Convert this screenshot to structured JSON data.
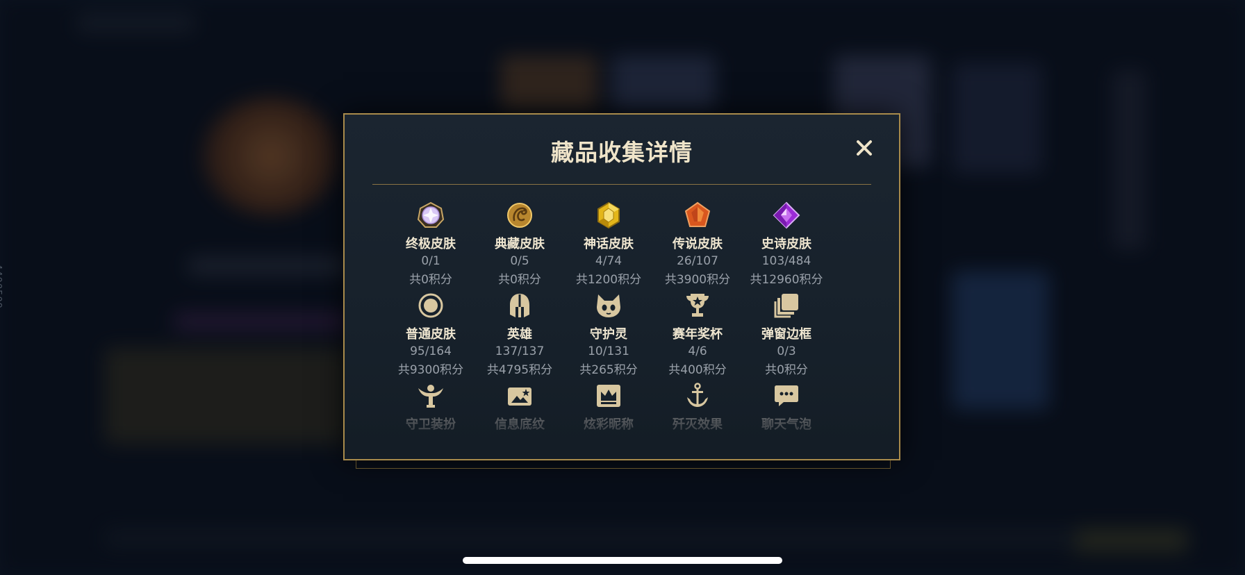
{
  "dialog": {
    "title": "藏品收集详情",
    "close_icon": "close-icon"
  },
  "side_text": "4400509",
  "colors": {
    "accent_gold": "#a98b4b",
    "panel_bg": "#17212b",
    "title_text": "#efe4c9",
    "muted_text": "#9aa1aa"
  },
  "rows": [
    [
      {
        "icon": "ultimate-skin-gem-icon",
        "label": "终极皮肤",
        "count": "0/1",
        "points": "共0积分"
      },
      {
        "icon": "prestige-dragon-emblem-icon",
        "label": "典藏皮肤",
        "count": "0/5",
        "points": "共0积分"
      },
      {
        "icon": "mythic-gem-icon",
        "label": "神话皮肤",
        "count": "4/74",
        "points": "共1200积分"
      },
      {
        "icon": "legendary-gem-icon",
        "label": "传说皮肤",
        "count": "26/107",
        "points": "共3900积分"
      },
      {
        "icon": "epic-gem-icon",
        "label": "史诗皮肤",
        "count": "103/484",
        "points": "共12960积分"
      }
    ],
    [
      {
        "icon": "normal-skin-circle-icon",
        "label": "普通皮肤",
        "count": "95/164",
        "points": "共9300积分"
      },
      {
        "icon": "champion-helmet-icon",
        "label": "英雄",
        "count": "137/137",
        "points": "共4795积分"
      },
      {
        "icon": "little-legend-icon",
        "label": "守护灵",
        "count": "10/131",
        "points": "共265积分"
      },
      {
        "icon": "trophy-icon",
        "label": "赛年奖杯",
        "count": "4/6",
        "points": "共400积分"
      },
      {
        "icon": "popup-frame-icon",
        "label": "弹窗边框",
        "count": "0/3",
        "points": "共0积分"
      }
    ],
    [
      {
        "icon": "ward-skin-icon",
        "label": "守卫装扮"
      },
      {
        "icon": "banner-icon",
        "label": "信息底纹"
      },
      {
        "icon": "crown-icon",
        "label": "炫彩昵称"
      },
      {
        "icon": "anchor-icon",
        "label": "歼灭效果"
      },
      {
        "icon": "chat-bubble-icon",
        "label": "聊天气泡"
      }
    ]
  ]
}
